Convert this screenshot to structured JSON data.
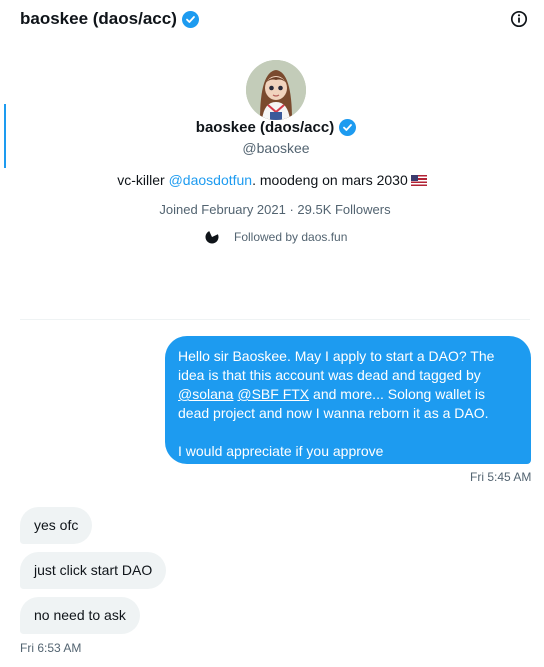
{
  "header": {
    "title": "baoskee (daos/acc)",
    "verified_icon": "verified-badge-icon",
    "info_icon": "info-icon"
  },
  "profile": {
    "name": "baoskee (daos/acc)",
    "handle": "@baoskee",
    "bio_prefix": "vc-killer ",
    "bio_mention": "@daosdotfun",
    "bio_suffix": ". moodeng on mars 2030",
    "bio_flag_icon": "us-flag-icon",
    "meta": "Joined February 2021 · 29.5K Followers",
    "followed_by": "Followed by daos.fun",
    "avatar_icon": "avatar-image",
    "accent_color": "#1d9bf0"
  },
  "conversation": {
    "outgoing": {
      "line1": "Hello sir Baoskee. May I apply to start a DAO? The idea is that this account was dead and tagged by ",
      "mention1": "@solana",
      "mention2": "@SBF FTX",
      "line2": " and more... Solong wallet is dead project and now I wanna reborn it as a DAO.",
      "paragraph2": "I would appreciate if you approve",
      "time": "Fri 5:45 AM"
    },
    "incoming": [
      {
        "text": "yes ofc"
      },
      {
        "text": "just click start DAO"
      },
      {
        "text": "no need to ask"
      }
    ],
    "incoming_time": "Fri 6:53 AM"
  }
}
